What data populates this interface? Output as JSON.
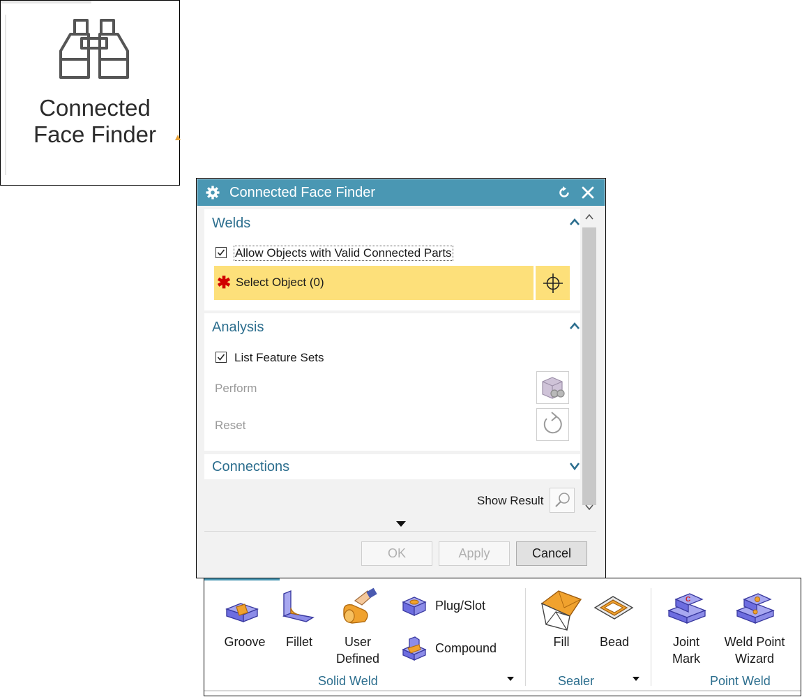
{
  "big_button": {
    "icon": "binoculars-icon",
    "label_line1": "Connected",
    "label_line2": "Face Finder"
  },
  "dialog": {
    "title": "Connected Face Finder",
    "title_icons": [
      "gear-icon",
      "reset-icon",
      "close-icon"
    ],
    "colors": {
      "titlebar": "#4a97b3",
      "selection_highlight": "#fde07a",
      "section_header_text": "#2c6e8e"
    },
    "welds": {
      "header": "Welds",
      "allow_objects_label": "Allow Objects with Valid Connected Parts",
      "allow_objects_checked": true,
      "select_object_label": "Select Object (0)"
    },
    "analysis": {
      "header": "Analysis",
      "list_feature_sets_label": "List Feature Sets",
      "list_feature_sets_checked": true,
      "perform_label": "Perform",
      "reset_label": "Reset"
    },
    "connections": {
      "header": "Connections"
    },
    "show_result_label": "Show Result",
    "buttons": {
      "ok": "OK",
      "apply": "Apply",
      "cancel": "Cancel"
    }
  },
  "ribbon": {
    "solid_weld": {
      "group_label": "Solid Weld",
      "groove": "Groove",
      "fillet": "Fillet",
      "user_defined_line1": "User",
      "user_defined_line2": "Defined",
      "plug_slot": "Plug/Slot",
      "compound": "Compound"
    },
    "sealer": {
      "group_label": "Sealer",
      "fill": "Fill",
      "bead": "Bead"
    },
    "point_weld": {
      "group_label": "Point Weld",
      "joint_mark_line1": "Joint",
      "joint_mark_line2": "Mark",
      "weld_point_wizard_line1": "Weld Point",
      "weld_point_wizard_line2": "Wizard"
    }
  }
}
